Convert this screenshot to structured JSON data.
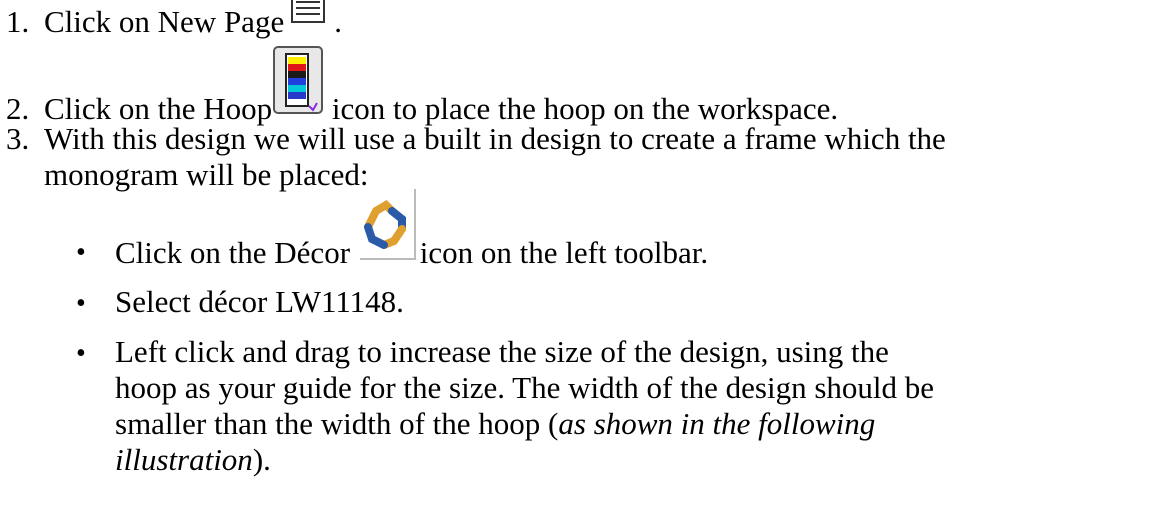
{
  "steps": [
    {
      "number": "1.",
      "text_before": "Click on New Page",
      "icon": "new-page-icon",
      "text_after": "."
    },
    {
      "number": "2.",
      "text_before": "Click on the Hoop",
      "icon": "hoop-icon",
      "text_after": " icon to place the hoop on the workspace."
    },
    {
      "number": "3.",
      "line1": "With this design we will use a built in design to create a frame which the",
      "line2": "monogram will be placed:"
    }
  ],
  "bullets": [
    {
      "symbol": "•",
      "text_before": "Click on the Décor ",
      "icon": "decor-icon",
      "text_after": "icon on the left toolbar."
    },
    {
      "symbol": "•",
      "text": "Select décor LW11148."
    },
    {
      "symbol": "•",
      "line1": "Left click and drag to increase the size of the design, using the",
      "line2": "hoop as your guide for the size. The width of the design should be",
      "line3_before": "smaller than the width of the hoop (",
      "line3_italic": "as shown in the following",
      "line4_italic": "illustration",
      "line4_after": ")."
    }
  ]
}
